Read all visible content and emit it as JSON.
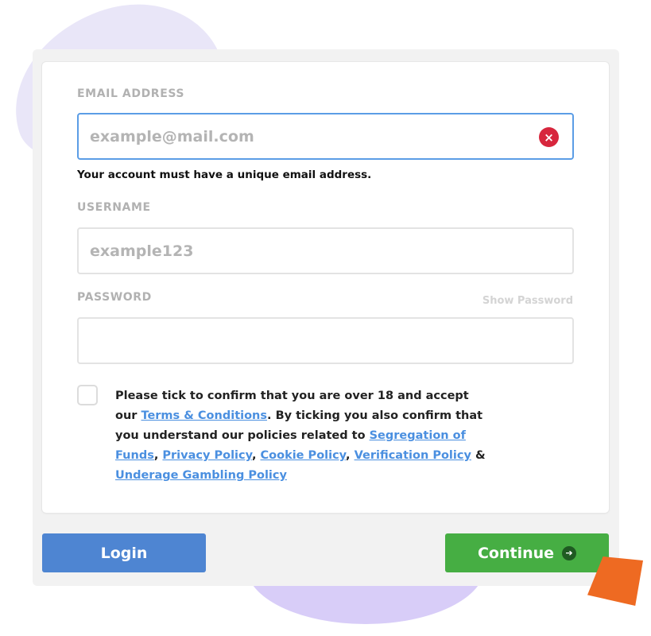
{
  "form": {
    "email": {
      "label": "EMAIL ADDRESS",
      "placeholder": "example@mail.com",
      "value": "",
      "helper": "Your account must have a unique email address.",
      "clear_icon": "×"
    },
    "username": {
      "label": "USERNAME",
      "placeholder": "example123",
      "value": ""
    },
    "password": {
      "label": "PASSWORD",
      "show_label": "Show Password",
      "value": ""
    },
    "terms": {
      "text_1": "Please tick to confirm that you are over 18 and accept our ",
      "link_terms": "Terms & Conditions",
      "text_2": ". By ticking you also confirm that you understand our policies related to ",
      "link_segregation": "Segregation of Funds",
      "text_3": ", ",
      "link_privacy": "Privacy Policy",
      "text_4": ", ",
      "link_cookie": "Cookie Policy",
      "text_5": ", ",
      "link_verification": "Verification Policy",
      "text_6": " & ",
      "link_underage": "Underage Gambling Policy",
      "checked": false
    }
  },
  "actions": {
    "login_label": "Login",
    "continue_label": "Continue",
    "continue_icon": "➔"
  },
  "colors": {
    "accent_blue": "#4e85d2",
    "accent_green": "#46ae43",
    "error_red": "#d7263d",
    "focus_border": "#5b9de6",
    "decor_orange": "#ee6a22",
    "decor_purple": "#d8cdf8"
  }
}
